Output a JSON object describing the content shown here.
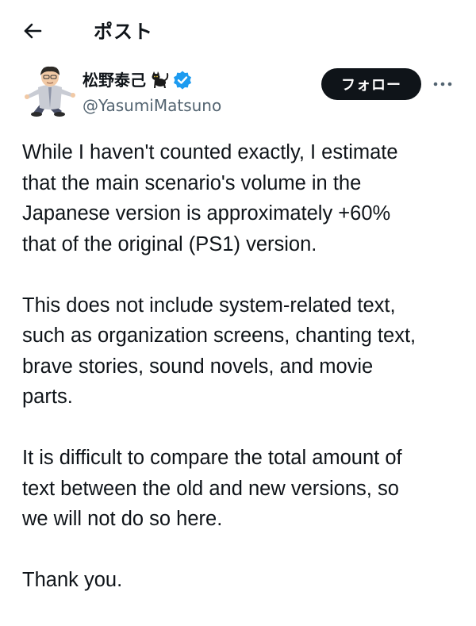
{
  "header": {
    "back_icon": "arrow-left-icon",
    "title": "ポスト"
  },
  "author": {
    "display_name": "松野泰己",
    "name_emoji": "black-cat-icon",
    "verified_icon": "verified-badge-icon",
    "verified_color": "#1d9bf0",
    "handle": "@YasumiMatsuno",
    "follow_label": "フォロー",
    "more_icon": "more-horizontal-icon"
  },
  "post": {
    "paragraphs": [
      "While I haven't counted exactly, I estimate\nthat the main scenario's volume in the\nJapanese version is approximately +60%\nthat of the original (PS1) version.",
      "This does not include system-related text,\nsuch as organization screens, chanting text,\nbrave stories, sound novels, and movie\nparts.",
      "It is difficult to compare the total amount of\ntext between the old and new versions, so\nwe will not do so here.",
      "Thank you."
    ]
  },
  "colors": {
    "text": "#0f1419",
    "secondary": "#536471",
    "follow_bg": "#0f1419"
  }
}
